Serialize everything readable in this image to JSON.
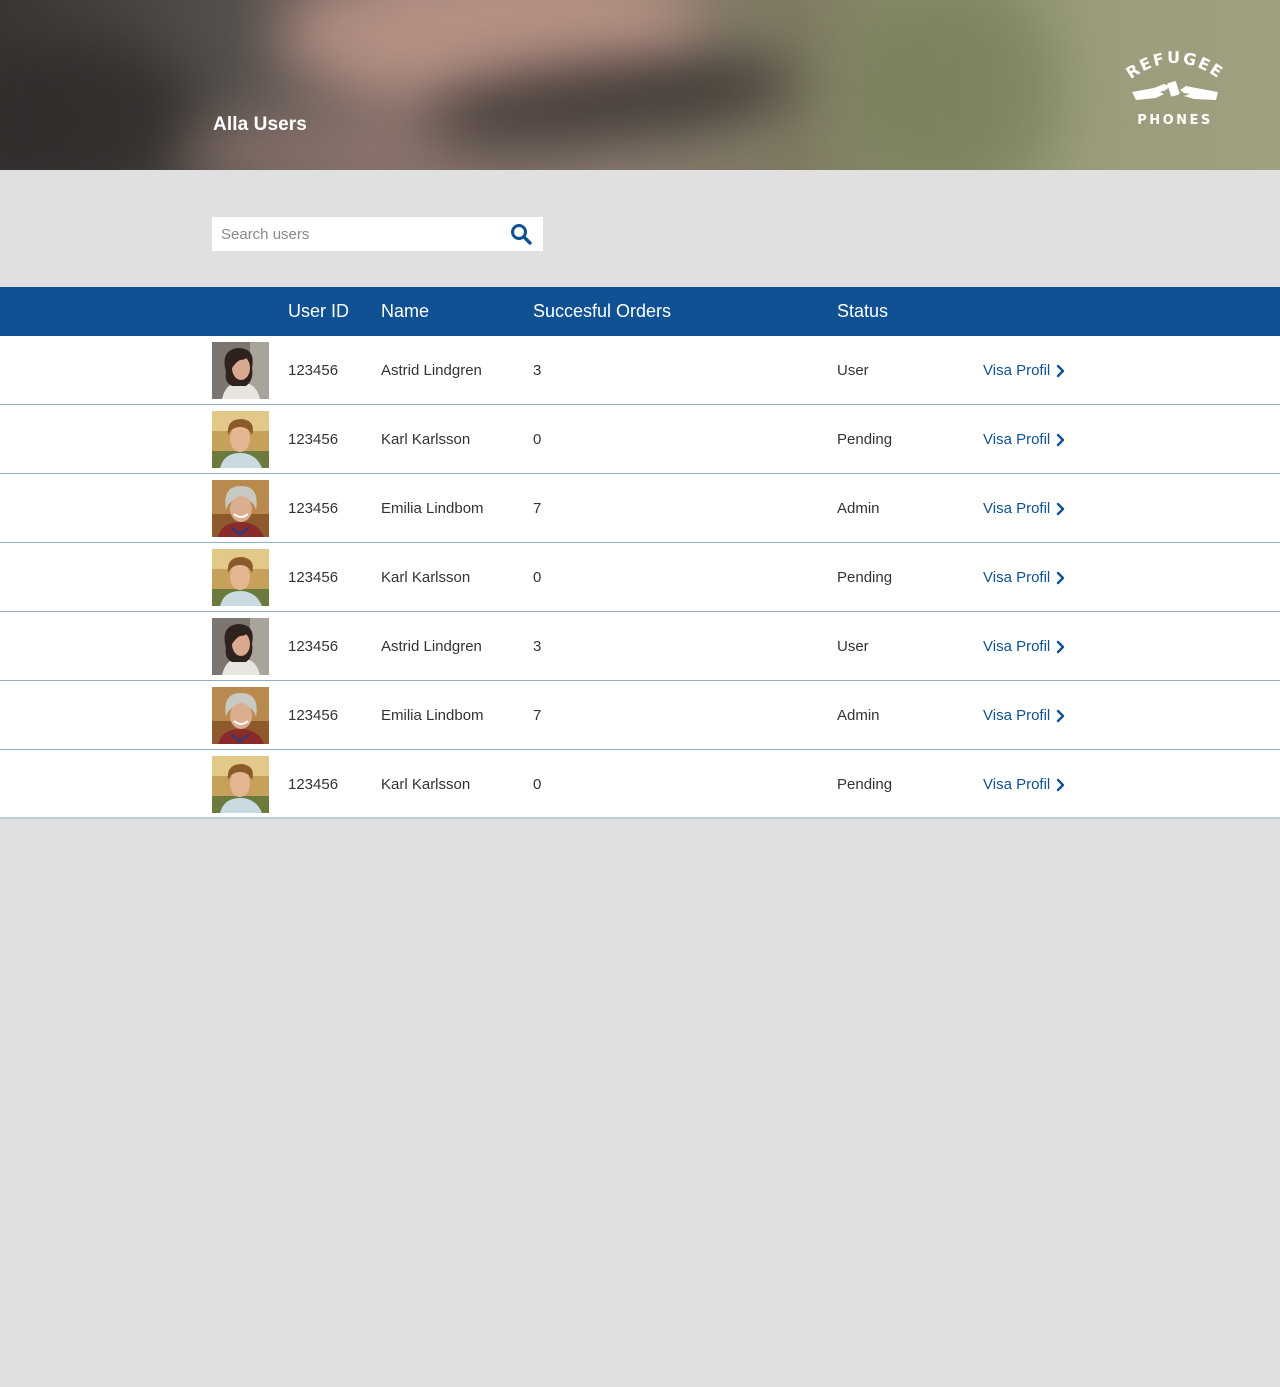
{
  "header": {
    "title": "Alla Users",
    "logo_text_top": "REFUGEE",
    "logo_text_bottom": "PHONES"
  },
  "search": {
    "placeholder": "Search users",
    "value": ""
  },
  "table": {
    "columns": {
      "user_id": "User ID",
      "name": "Name",
      "orders": "Succesful Orders",
      "status": "Status"
    },
    "rows": [
      {
        "avatar": "woman-dark-hair",
        "user_id": "123456",
        "name": "Astrid Lindgren",
        "orders": "3",
        "status": "User",
        "status_type": "user",
        "link": "Visa Profil"
      },
      {
        "avatar": "young-man",
        "user_id": "123456",
        "name": "Karl Karlsson",
        "orders": "0",
        "status": "Pending",
        "status_type": "pending",
        "link": "Visa Profil"
      },
      {
        "avatar": "older-woman",
        "user_id": "123456",
        "name": "Emilia Lindbom",
        "orders": "7",
        "status": "Admin",
        "status_type": "admin",
        "link": "Visa Profil"
      },
      {
        "avatar": "young-man",
        "user_id": "123456",
        "name": "Karl Karlsson",
        "orders": "0",
        "status": "Pending",
        "status_type": "pending",
        "link": "Visa Profil"
      },
      {
        "avatar": "woman-dark-hair",
        "user_id": "123456",
        "name": "Astrid Lindgren",
        "orders": "3",
        "status": "User",
        "status_type": "user",
        "link": "Visa Profil"
      },
      {
        "avatar": "older-woman",
        "user_id": "123456",
        "name": "Emilia Lindbom",
        "orders": "7",
        "status": "Admin",
        "status_type": "admin",
        "link": "Visa Profil"
      },
      {
        "avatar": "young-man",
        "user_id": "123456",
        "name": "Karl Karlsson",
        "orders": "0",
        "status": "Pending",
        "status_type": "pending",
        "link": "Visa Profil"
      }
    ]
  },
  "colors": {
    "brand_blue": "#0f5192",
    "status_user": "#6aaa2a",
    "status_admin": "#6aaa2a",
    "status_pending": "#f0a020",
    "background": "#e0e0e0"
  },
  "icons": {
    "search": "search-icon",
    "chevron": "chevron-right-icon",
    "logo": "refugee-phones-logo"
  }
}
